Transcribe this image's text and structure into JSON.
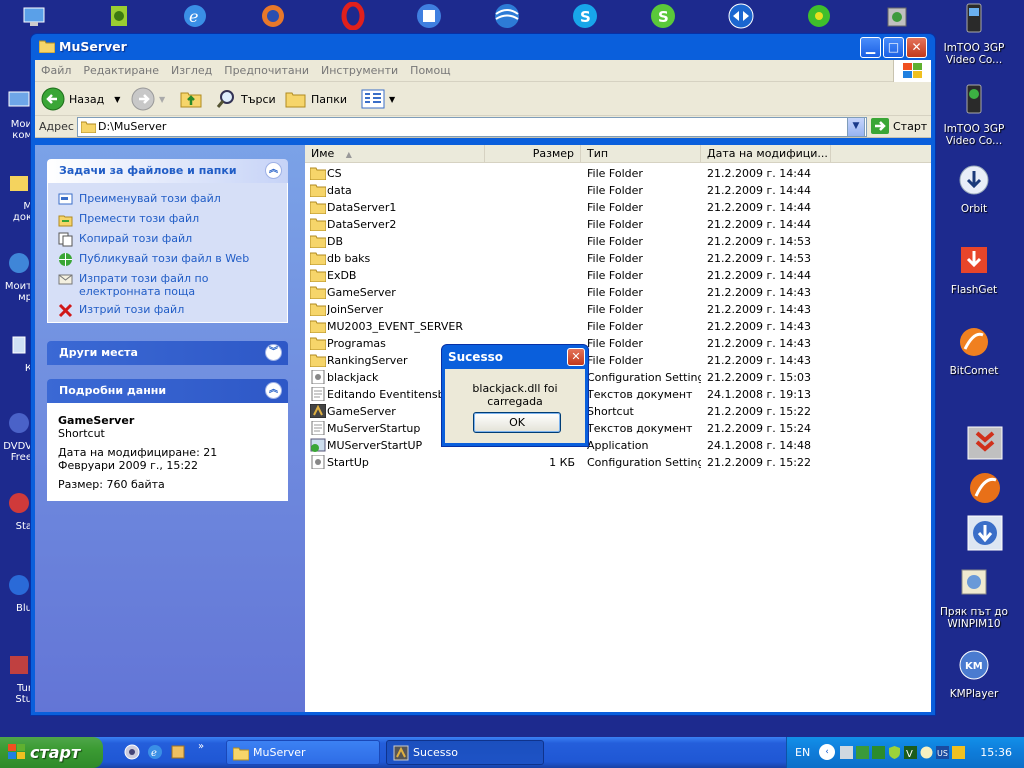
{
  "window": {
    "title": "MuServer",
    "menu": [
      "Файл",
      "Редактиране",
      "Изглед",
      "Предпочитани",
      "Инструменти",
      "Помощ"
    ],
    "toolbar": {
      "back": "Назад",
      "search": "Търси",
      "folders": "Папки"
    },
    "address": {
      "label": "Адрес",
      "value": "D:\\MuServer",
      "go": "Старт"
    }
  },
  "tasks": {
    "title": "Задачи за файлове и папки",
    "items": [
      "Преименувай този файл",
      "Премести този файл",
      "Копирай този файл",
      "Публикувай този файл в Web",
      "Изпрати този файл по електронната поща",
      "Изтрий този файл"
    ]
  },
  "other_places": {
    "title": "Други места"
  },
  "details": {
    "title": "Подробни данни",
    "name": "GameServer",
    "type": "Shortcut",
    "modified": "Дата на модифициране: 21 Февруари 2009 г., 15:22",
    "size": "Размер: 760 байта"
  },
  "columns": {
    "name": "Име",
    "size": "Размер",
    "type": "Тип",
    "date": "Дата на модифици..."
  },
  "files": [
    {
      "name": "CS",
      "size": "",
      "type": "File Folder",
      "date": "21.2.2009 г. 14:44",
      "icon": "folder-icon"
    },
    {
      "name": "data",
      "size": "",
      "type": "File Folder",
      "date": "21.2.2009 г. 14:44",
      "icon": "folder-icon"
    },
    {
      "name": "DataServer1",
      "size": "",
      "type": "File Folder",
      "date": "21.2.2009 г. 14:44",
      "icon": "folder-icon"
    },
    {
      "name": "DataServer2",
      "size": "",
      "type": "File Folder",
      "date": "21.2.2009 г. 14:44",
      "icon": "folder-icon"
    },
    {
      "name": "DB",
      "size": "",
      "type": "File Folder",
      "date": "21.2.2009 г. 14:53",
      "icon": "folder-icon"
    },
    {
      "name": "db baks",
      "size": "",
      "type": "File Folder",
      "date": "21.2.2009 г. 14:53",
      "icon": "folder-icon"
    },
    {
      "name": "ExDB",
      "size": "",
      "type": "File Folder",
      "date": "21.2.2009 г. 14:44",
      "icon": "folder-icon"
    },
    {
      "name": "GameServer",
      "size": "",
      "type": "File Folder",
      "date": "21.2.2009 г. 14:43",
      "icon": "folder-icon"
    },
    {
      "name": "JoinServer",
      "size": "",
      "type": "File Folder",
      "date": "21.2.2009 г. 14:43",
      "icon": "folder-icon"
    },
    {
      "name": "MU2003_EVENT_SERVER",
      "size": "",
      "type": "File Folder",
      "date": "21.2.2009 г. 14:43",
      "icon": "folder-icon"
    },
    {
      "name": "Programas",
      "size": "",
      "type": "File Folder",
      "date": "21.2.2009 г. 14:43",
      "icon": "folder-icon"
    },
    {
      "name": "RankingServer",
      "size": "",
      "type": "File Folder",
      "date": "21.2.2009 г. 14:43",
      "icon": "folder-icon"
    },
    {
      "name": "blackjack",
      "size": "",
      "type": "Configuration Settings",
      "date": "21.2.2009 г. 15:03",
      "icon": "settings-file-icon"
    },
    {
      "name": "Editando Eventitensbag",
      "size": "",
      "type": "Текстов документ",
      "date": "24.1.2008 г. 19:13",
      "icon": "text-file-icon"
    },
    {
      "name": "GameServer",
      "size": "",
      "type": "Shortcut",
      "date": "21.2.2009 г. 15:22",
      "icon": "shortcut-icon"
    },
    {
      "name": "MuServerStartup",
      "size": "",
      "type": "Текстов документ",
      "date": "21.2.2009 г. 15:24",
      "icon": "text-file-icon"
    },
    {
      "name": "MUServerStartUP",
      "size": "",
      "type": "Application",
      "date": "24.1.2008 г. 14:48",
      "icon": "application-icon"
    },
    {
      "name": "StartUp",
      "size": "1 КБ",
      "type": "Configuration Settings",
      "date": "21.2.2009 г. 15:22",
      "icon": "settings-file-icon"
    }
  ],
  "dialog": {
    "title": "Sucesso",
    "message": "blackjack.dll foi carregada",
    "ok": "OK"
  },
  "desktop": {
    "right_icons": [
      {
        "label": "ImTOO 3GP Video Co...",
        "icon": "phone-icon"
      },
      {
        "label": "ImTOO 3GP Video Co...",
        "icon": "phone-icon"
      },
      {
        "label": "Orbit",
        "icon": "orbit-download-icon"
      },
      {
        "label": "FlashGet",
        "icon": "flashget-icon"
      },
      {
        "label": "BitComet",
        "icon": "bitcomet-icon"
      },
      {
        "label": "Пряк път до WINPIM10",
        "icon": "winpim-icon"
      },
      {
        "label": "KMPlayer",
        "icon": "kmplayer-icon"
      }
    ],
    "left_partial_labels": [
      "Мои\nком",
      "М\nдок",
      "Моит\nмр",
      "К",
      "DVDV\nFree",
      "Sta",
      "Blu",
      "Tur\nStu"
    ]
  },
  "taskbar": {
    "start": "старт",
    "buttons": [
      {
        "label": "MuServer"
      },
      {
        "label": "Sucesso"
      }
    ],
    "lang": "EN",
    "clock": "15:36"
  },
  "colors": {
    "xp_blue": "#0a5fdc",
    "task_link": "#215dc6",
    "desktop": "#1d2a8e",
    "start_green": "#3b9b33"
  }
}
